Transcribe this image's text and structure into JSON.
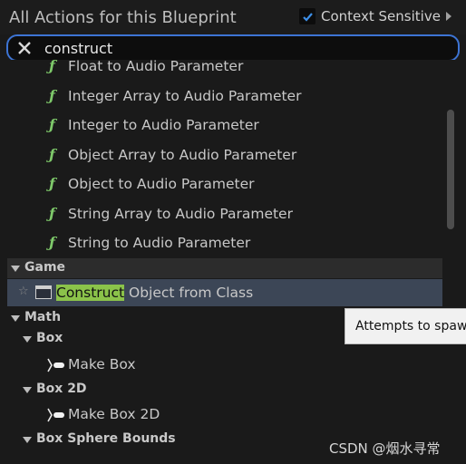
{
  "header": {
    "title": "All Actions for this Blueprint",
    "context_sensitive_label": "Context Sensitive",
    "context_sensitive_checked": true
  },
  "search": {
    "value": "construct"
  },
  "items": [
    {
      "icon": "function-icon",
      "label": "Float to Audio Parameter"
    },
    {
      "icon": "function-icon",
      "label": "Integer Array to Audio Parameter"
    },
    {
      "icon": "function-icon",
      "label": "Integer to Audio Parameter"
    },
    {
      "icon": "function-icon",
      "label": "Object Array to Audio Parameter"
    },
    {
      "icon": "function-icon",
      "label": "Object to Audio Parameter"
    },
    {
      "icon": "function-icon",
      "label": "String Array to Audio Parameter"
    },
    {
      "icon": "function-icon",
      "label": "String to Audio Parameter"
    }
  ],
  "game": {
    "label": "Game",
    "selected_item": {
      "highlight": "Construct",
      "rest": " Object from Class"
    }
  },
  "math": {
    "label": "Math",
    "box": {
      "label": "Box",
      "item": "Make Box"
    },
    "box2d": {
      "label": "Box 2D",
      "item": "Make Box 2D"
    },
    "box_sphere": {
      "label": "Box Sphere Bounds"
    }
  },
  "function_glyph": "ƒ",
  "tooltip": "Attempts to spawn",
  "watermark": "CSDN @烟水寻常",
  "colors": {
    "accent": "#3d74d4",
    "function_icon": "#7ec96a",
    "highlight": "#8bc34a",
    "selected_row": "#3c4656"
  }
}
